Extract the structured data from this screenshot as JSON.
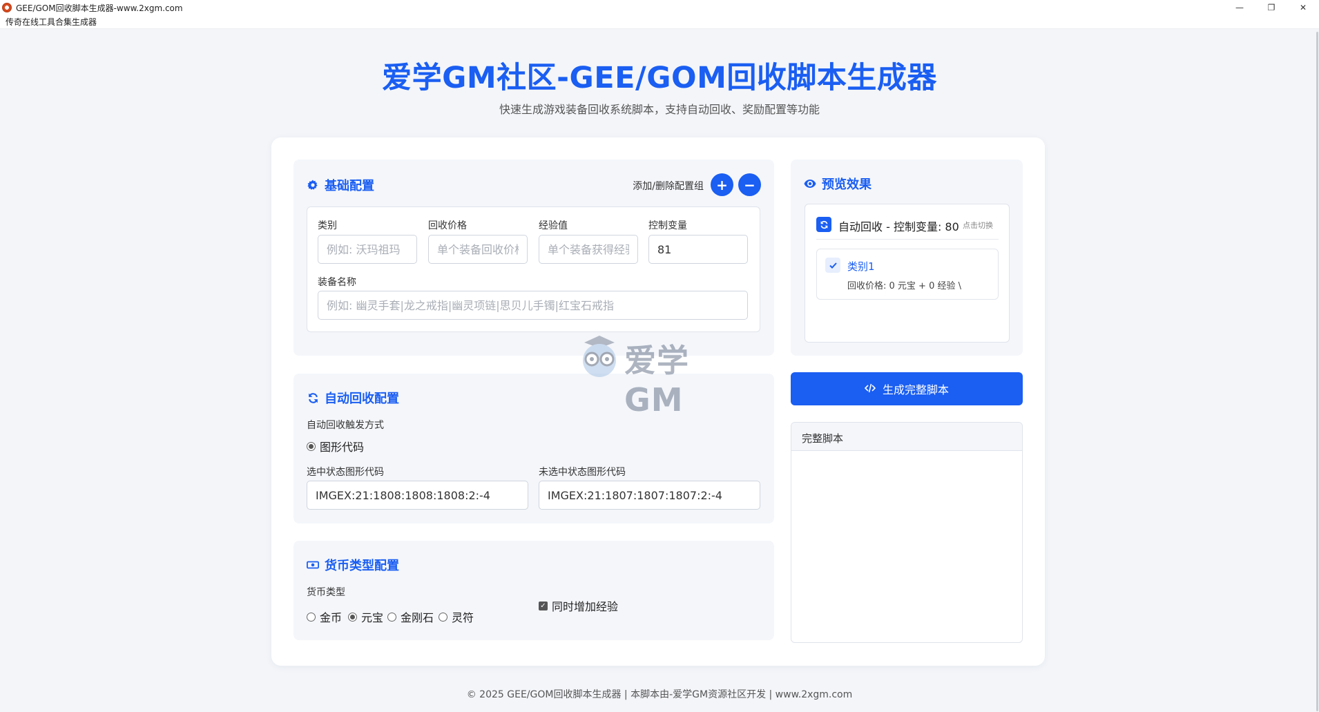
{
  "window": {
    "title": "GEE/GOM回收脚本生成器-www.2xgm.com",
    "minimize": "—",
    "maximize": "❐",
    "close": "✕"
  },
  "menubar": {
    "item": "传奇在线工具合集生成器"
  },
  "header": {
    "title": "爱学GM社区-GEE/GOM回收脚本生成器",
    "subtitle": "快速生成游戏装备回收系统脚本，支持自动回收、奖励配置等功能"
  },
  "basic_config": {
    "title": "基础配置",
    "icon": "gear-icon",
    "add_remove_label": "添加/删除配置组",
    "add_symbol": "+",
    "remove_symbol": "−",
    "category_label": "类别",
    "category_placeholder": "例如: 沃玛祖玛",
    "price_label": "回收价格",
    "price_placeholder": "单个装备回收价格",
    "exp_label": "经验值",
    "exp_placeholder": "单个装备获得经验",
    "var_label": "控制变量",
    "var_value": "81",
    "equip_label": "装备名称",
    "equip_placeholder": "例如: 幽灵手套|龙之戒指|幽灵项链|思贝儿手镯|红宝石戒指"
  },
  "auto_recycle": {
    "title": "自动回收配置",
    "icon": "sync-icon",
    "trigger_label": "自动回收触发方式",
    "trigger_option": "图形代码",
    "selected_label": "选中状态图形代码",
    "selected_value": "IMGEX:21:1808:1808:1808:2:-4",
    "unselected_label": "未选中状态图形代码",
    "unselected_value": "IMGEX:21:1807:1807:1807:2:-4"
  },
  "currency": {
    "title": "货币类型配置",
    "icon": "money-icon",
    "type_label": "货币类型",
    "options": [
      "金币",
      "元宝",
      "金刚石",
      "灵符"
    ],
    "selected": "元宝",
    "add_exp_label": "同时增加经验",
    "add_exp_checked": true
  },
  "preview": {
    "title": "预览效果",
    "icon": "eye-icon",
    "head_text": "自动回收 - 控制变量: 80",
    "head_hint": "点击切换",
    "item_title": "类别1",
    "item_desc": "回收价格: 0 元宝 + 0 经验 \\"
  },
  "generate_button": "生成完整脚本",
  "script_box": {
    "title": "完整脚本"
  },
  "watermark": {
    "text": "爱学GM"
  },
  "footer": "© 2025 GEE/GOM回收脚本生成器 | 本脚本由-爱学GM资源社区开发 | www.2xgm.com",
  "colors": {
    "accent": "#1a5ef2",
    "panel_bg": "#f4f6fa",
    "page_bg": "#f3f5f9"
  }
}
